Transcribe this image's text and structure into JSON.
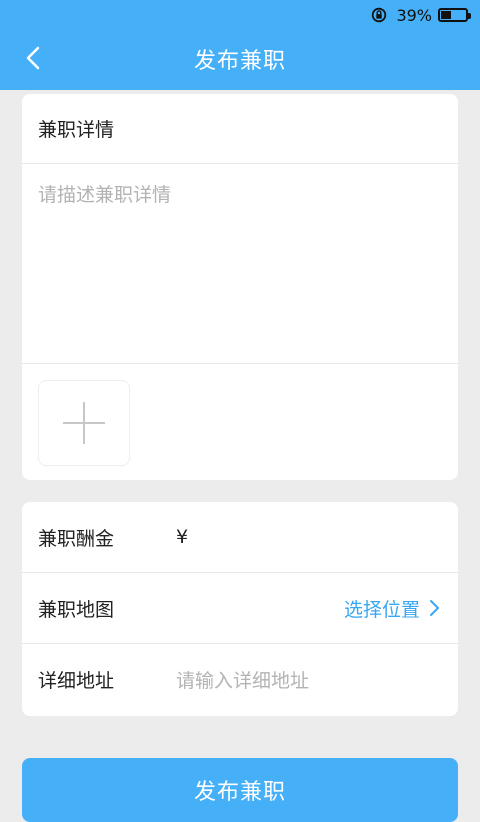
{
  "status": {
    "battery": "39%"
  },
  "header": {
    "title": "发布兼职"
  },
  "details": {
    "title": "兼职详情",
    "placeholder": "请描述兼职详情"
  },
  "form": {
    "pay_label": "兼职酬金",
    "pay_symbol": "¥",
    "map_label": "兼职地图",
    "map_action": "选择位置",
    "address_label": "详细地址",
    "address_placeholder": "请输入详细地址"
  },
  "submit": {
    "label": "发布兼职"
  },
  "colors": {
    "accent": "#45b0f7",
    "link": "#38a7f2"
  }
}
